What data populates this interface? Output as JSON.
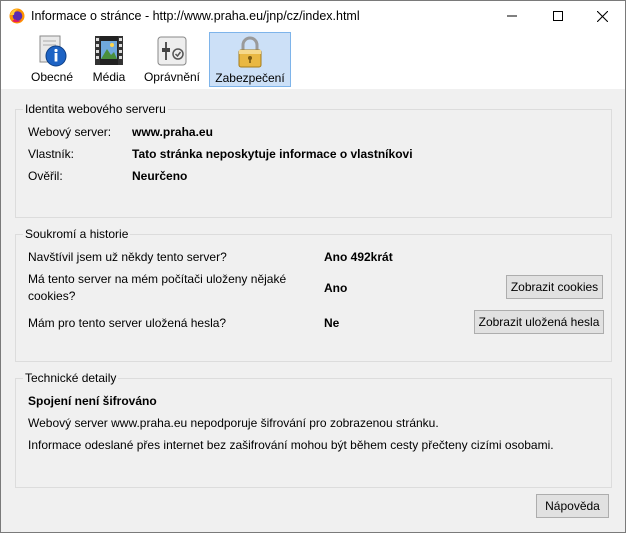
{
  "window": {
    "title": "Informace o stránce - http://www.praha.eu/jnp/cz/index.html"
  },
  "toolbar": {
    "tabs": [
      {
        "label": "Obecné",
        "icon": "info-icon"
      },
      {
        "label": "Média",
        "icon": "media-icon"
      },
      {
        "label": "Oprávnění",
        "icon": "permissions-icon"
      },
      {
        "label": "Zabezpečení",
        "icon": "lock-icon",
        "active": true
      }
    ]
  },
  "identity": {
    "title": "Identita webového serveru",
    "server_label": "Webový server:",
    "server_value": "www.praha.eu",
    "owner_label": "Vlastník:",
    "owner_value": "Tato stránka neposkytuje informace o vlastníkovi",
    "verified_label": "Ověřil:",
    "verified_value": "Neurčeno"
  },
  "privacy": {
    "title": "Soukromí a historie",
    "visited_label": "Navštívil jsem už někdy tento server?",
    "visited_value": "Ano 492krát",
    "cookies_label": "Má tento server na mém počítači uloženy nějaké cookies?",
    "cookies_value": "Ano",
    "cookies_button": "Zobrazit cookies",
    "passwords_label": "Mám pro tento server uložená hesla?",
    "passwords_value": "Ne",
    "passwords_button": "Zobrazit uložená hesla"
  },
  "technical": {
    "title": "Technické detaily",
    "heading": "Spojení není šifrováno",
    "line1": "Webový server www.praha.eu nepodporuje šifrování pro zobrazenou stránku.",
    "line2": "Informace odeslané přes internet bez zašifrování mohou být během cesty přečteny cizími osobami."
  },
  "footer": {
    "help_button": "Nápověda"
  },
  "colors": {
    "active_tab_bg": "#cce0f7",
    "active_tab_border": "#7eb4ea",
    "dialog_bg": "#f0f0f0"
  }
}
